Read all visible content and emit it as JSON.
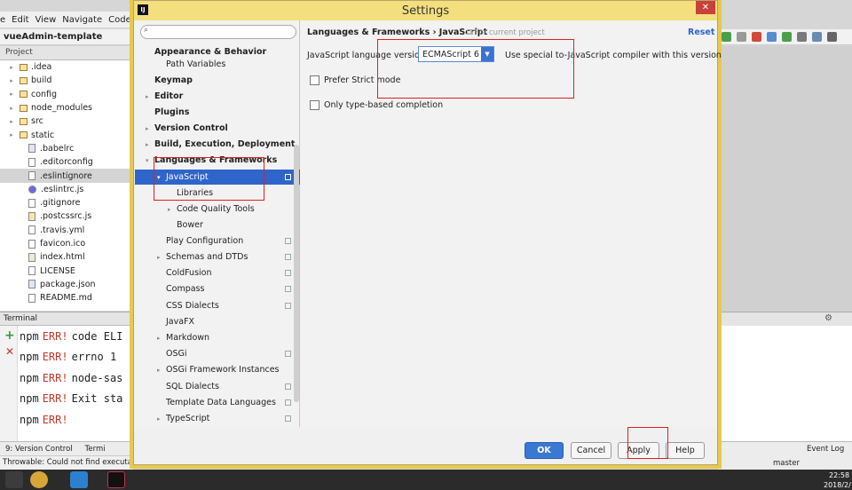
{
  "ide": {
    "menu": [
      "e",
      "Edit",
      "View",
      "Navigate",
      "Code"
    ],
    "project_name": "vueAdmin-template",
    "project_panel": "Project",
    "tree": [
      {
        "label": ".idea",
        "kind": "folder"
      },
      {
        "label": "build",
        "kind": "folder"
      },
      {
        "label": "config",
        "kind": "folder"
      },
      {
        "label": "node_modules",
        "kind": "folder"
      },
      {
        "label": "src",
        "kind": "folder"
      },
      {
        "label": "static",
        "kind": "folder"
      },
      {
        "label": ".babelrc",
        "kind": "json"
      },
      {
        "label": ".editorconfig",
        "kind": "file"
      },
      {
        "label": ".eslintignore",
        "kind": "file",
        "selected": true
      },
      {
        "label": ".eslintrc.js",
        "kind": "eslint"
      },
      {
        "label": ".gitignore",
        "kind": "file"
      },
      {
        "label": ".postcssrc.js",
        "kind": "js"
      },
      {
        "label": ".travis.yml",
        "kind": "file"
      },
      {
        "label": "favicon.ico",
        "kind": "file"
      },
      {
        "label": "index.html",
        "kind": "html"
      },
      {
        "label": "LICENSE",
        "kind": "file"
      },
      {
        "label": "package.json",
        "kind": "json"
      },
      {
        "label": "README.md",
        "kind": "file"
      }
    ],
    "terminal_title": "Terminal",
    "terminal_lines": [
      {
        "prefix": "npm",
        "err": "ERR!",
        "rest": "code ELI"
      },
      {
        "prefix": "npm",
        "err": "ERR!",
        "rest": "errno 1"
      },
      {
        "prefix": "npm",
        "err": "ERR!",
        "rest": "node-sas"
      },
      {
        "prefix": "npm",
        "err": "ERR!",
        "rest": "Exit sta"
      },
      {
        "prefix": "npm",
        "err": "ERR!",
        "rest": ""
      }
    ],
    "bottom_tabs": [
      "9: Version Control",
      "Termi"
    ],
    "status_text": "Throwable: Could not find executable",
    "right_bottom": {
      "event_log": "Event Log",
      "branch": "master"
    },
    "clock": {
      "time": "22:58",
      "date": "2018/2/"
    }
  },
  "dialog": {
    "title": "Settings",
    "logo": "IJ",
    "close": "✕",
    "search_placeholder": "",
    "sidebar": [
      {
        "label": "Appearance & Behavior",
        "bold": true,
        "indent": 0
      },
      {
        "label": "Path Variables",
        "indent": 1
      },
      {
        "label": "Keymap",
        "bold": true,
        "indent": 0
      },
      {
        "label": "Editor",
        "bold": true,
        "indent": 0,
        "arrow": "▸"
      },
      {
        "label": "Plugins",
        "bold": true,
        "indent": 0
      },
      {
        "label": "Version Control",
        "bold": true,
        "indent": 0,
        "arrow": "▸"
      },
      {
        "label": "Build, Execution, Deployment",
        "bold": true,
        "indent": 0,
        "arrow": "▸"
      },
      {
        "label": "Languages & Frameworks",
        "bold": true,
        "indent": 0,
        "arrow": "▾"
      },
      {
        "label": "JavaScript",
        "indent": 1,
        "arrow": "▾",
        "selected": true,
        "copy": true
      },
      {
        "label": "Libraries",
        "indent": 2
      },
      {
        "label": "Code Quality Tools",
        "indent": 2,
        "arrow": "▸"
      },
      {
        "label": "Bower",
        "indent": 2
      },
      {
        "label": "Play Configuration",
        "indent": 1,
        "copy": true
      },
      {
        "label": "Schemas and DTDs",
        "indent": 1,
        "arrow": "▸",
        "copy": true
      },
      {
        "label": "ColdFusion",
        "indent": 1,
        "copy": true
      },
      {
        "label": "Compass",
        "indent": 1,
        "copy": true
      },
      {
        "label": "CSS Dialects",
        "indent": 1,
        "copy": true
      },
      {
        "label": "JavaFX",
        "indent": 1
      },
      {
        "label": "Markdown",
        "indent": 1,
        "arrow": "▸"
      },
      {
        "label": "OSGi",
        "indent": 1,
        "copy": true
      },
      {
        "label": "OSGi Framework Instances",
        "indent": 1,
        "arrow": "▸"
      },
      {
        "label": "SQL Dialects",
        "indent": 1,
        "copy": true
      },
      {
        "label": "Template Data Languages",
        "indent": 1,
        "copy": true
      },
      {
        "label": "TypeScript",
        "indent": 1,
        "arrow": "▸",
        "copy": true
      }
    ],
    "breadcrumb": "Languages & Frameworks › JavaScript",
    "breadcrumb_note": "For current project",
    "reset": "Reset",
    "language_label": "JavaScript language version",
    "language_value": "ECMAScript 6",
    "language_hint": "Use special to-JavaScript compiler with this version",
    "prefer_strict": "Prefer Strict mode",
    "type_based": "Only type-based completion",
    "ok": "OK",
    "cancel": "Cancel",
    "apply": "Apply",
    "help": "Help"
  },
  "colors": {
    "selection": "#2f65ca",
    "annotation": "#e02020",
    "dialog_title": "#f3df7e"
  }
}
